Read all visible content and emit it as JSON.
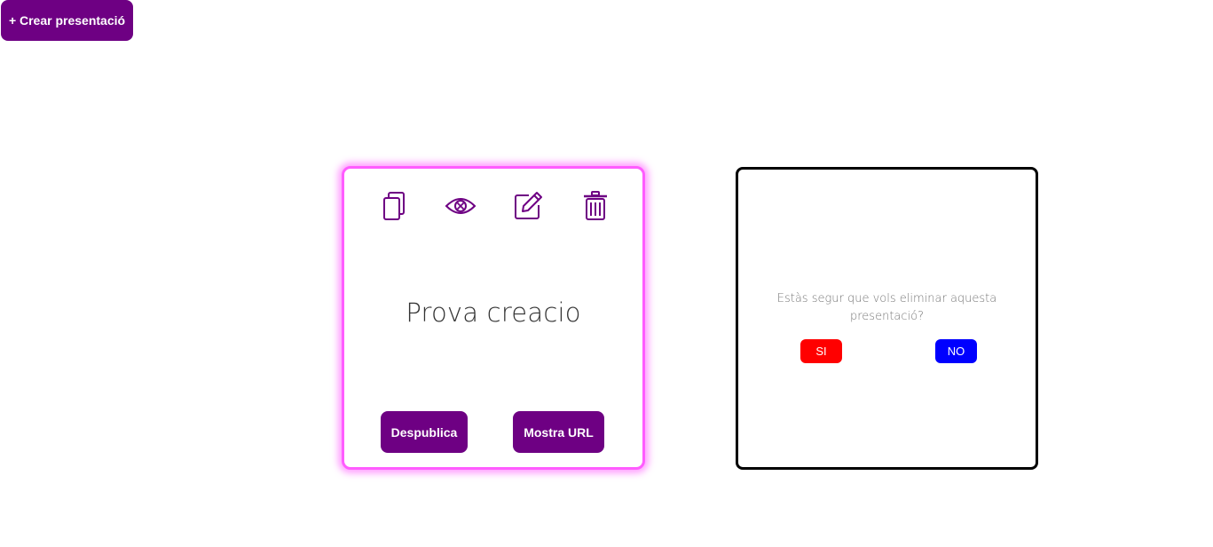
{
  "toolbar": {
    "create_label": "+ Crear presentació"
  },
  "card": {
    "title": "Prova creacio",
    "icons": [
      "copy-icon",
      "eye-icon",
      "edit-icon",
      "trash-icon"
    ],
    "unpublish_label": "Despublica",
    "show_url_label": "Mostra URL"
  },
  "dialog": {
    "message": "Estàs segur que vols eliminar aquesta presentació?",
    "yes_label": "SI",
    "no_label": "NO"
  },
  "colors": {
    "brand_purple": "#6e0083",
    "card_glow": "#ff5cff",
    "yes_red": "#ff0000",
    "no_blue": "#0000ff"
  }
}
